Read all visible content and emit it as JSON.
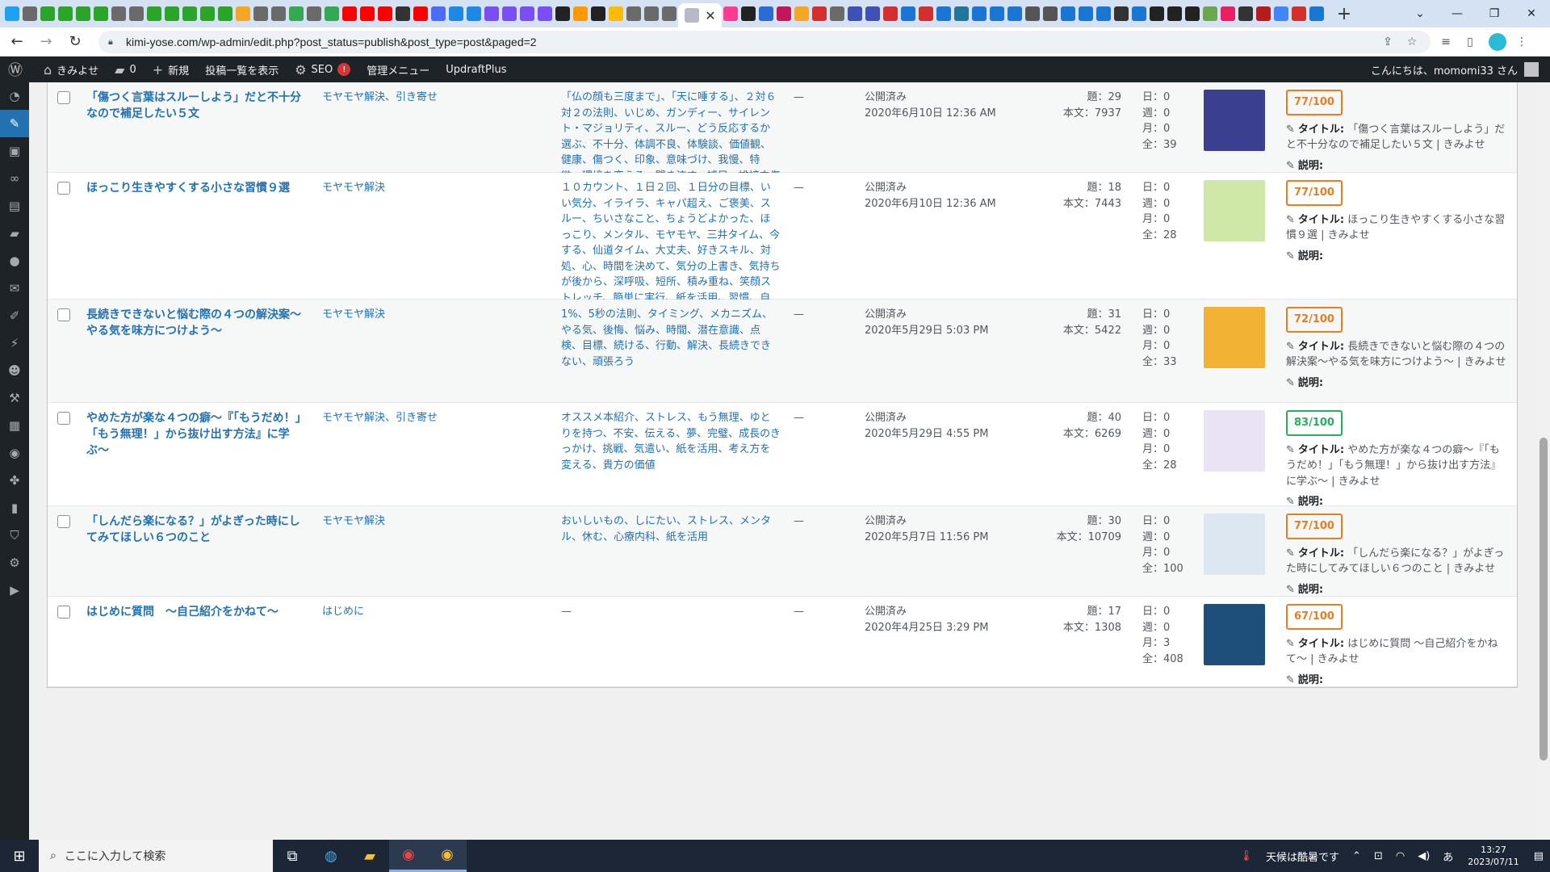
{
  "browser": {
    "active_tab_close": "✕",
    "new_tab": "+",
    "url": "kimi-yose.com/wp-admin/edit.php?post_status=publish&post_type=post&paged=2",
    "window_controls": [
      "⌄",
      "—",
      "❐",
      "✕"
    ]
  },
  "adminbar": {
    "site_name": "きみよせ",
    "comments_count": "0",
    "new_label": "新規",
    "view_posts": "投稿一覧を表示",
    "seo_label": "SEO",
    "seo_badge": "!",
    "admin_menu": "管理メニュー",
    "updraft": "UpdraftPlus",
    "greeting": "こんにちは、momomi33 さん"
  },
  "posts": [
    {
      "title": "「傷つく言葉はスルーしよう」だと不十分なので補足したい５文",
      "categories": "モヤモヤ解決、引き寄せ",
      "tags": "「仏の顔も三度まで」、「天に唾する」、２対６対２の法則、いじめ、ガンディー、サイレント・マジョリティ、スルー、どう反応するか選ぶ、不十分、体調不良、体験談、価値観、健康、傷つく、印象、意味づけ、我慢、特徴、環境を変える、聞き流す、補足、誹謗中傷",
      "comments": "—",
      "status": "公開済み",
      "date": "2020年6月10日 12:36 AM",
      "title_chars": "題：29",
      "body_chars": "本文：7937",
      "views": [
        "日：0",
        "週：0",
        "月：0",
        "全：39"
      ],
      "thumb_color": "#3b3f8f",
      "score": "77/100",
      "score_color": "orange",
      "seo_title_label": "タイトル:",
      "seo_title": "「傷つく言葉はスルーしよう」だと不十分なので補足したい５文 | きみよせ",
      "seo_desc_label": "説明:"
    },
    {
      "title": "ほっこり生きやすくする小さな習慣９選",
      "categories": "モヤモヤ解決",
      "tags": "１０カウント、１日２回、１日分の目標、いい気分、イライラ、キャパ超え、ご褒美、スルー、ちいさなこと、ちょうどよかった、ほっこり、メンタル、モヤモヤ、三井タイム、今する、仙道タイム、大丈夫、好きスキル、対処、心、時間を決めて、気分の上書き、気持ちが後から、深呼吸、短所、積み重ね、笑顔ストレッチ、簡単に実行、紙を活用、習慣、自信、落ち込む、重要なこと、長所、面倒",
      "comments": "—",
      "status": "公開済み",
      "date": "2020年6月10日 12:36 AM",
      "title_chars": "題：18",
      "body_chars": "本文：7443",
      "views": [
        "日：0",
        "週：0",
        "月：0",
        "全：28"
      ],
      "thumb_color": "#cfe8a8",
      "score": "77/100",
      "score_color": "orange",
      "seo_title_label": "タイトル:",
      "seo_title": "ほっこり生きやすくする小さな習慣９選 | きみよせ",
      "seo_desc_label": "説明:"
    },
    {
      "title": "長続きできないと悩む際の４つの解決案〜やる気を味方につけよう〜",
      "categories": "モヤモヤ解決",
      "tags": "1%、5秒の法則、タイミング、メカニズム、やる気、後悔、悩み、時間、潜在意識、点検、目標、続ける、行動、解決、長続きできない、頑張ろう",
      "comments": "—",
      "status": "公開済み",
      "date": "2020年5月29日 5:03 PM",
      "title_chars": "題：31",
      "body_chars": "本文：5422",
      "views": [
        "日：0",
        "週：0",
        "月：0",
        "全：33"
      ],
      "thumb_color": "#f2b233",
      "score": "72/100",
      "score_color": "orange",
      "seo_title_label": "タイトル:",
      "seo_title": "長続きできないと悩む際の４つの解決案〜やる気を味方につけよう〜 | きみよせ",
      "seo_desc_label": "説明:"
    },
    {
      "title": "やめた方が楽な４つの癖〜『「もうだめ！」「もう無理！」から抜け出す方法』に学ぶ〜",
      "categories": "モヤモヤ解決、引き寄せ",
      "tags": "オススメ本紹介、ストレス、もう無理、ゆとりを持つ、不安、伝える、夢、完璧、成長のきっかけ、挑戦、気遣い、紙を活用、考え方を変える、貴方の価値",
      "comments": "—",
      "status": "公開済み",
      "date": "2020年5月29日 4:55 PM",
      "title_chars": "題：40",
      "body_chars": "本文：6269",
      "views": [
        "日：0",
        "週：0",
        "月：0",
        "全：28"
      ],
      "thumb_color": "#e9e3f5",
      "score": "83/100",
      "score_color": "green",
      "seo_title_label": "タイトル:",
      "seo_title": "やめた方が楽な４つの癖〜『「もうだめ！」「もう無理！」から抜け出す方法』に学ぶ〜 | きみよせ",
      "seo_desc_label": "説明:"
    },
    {
      "title": "「しんだら楽になる？」がよぎった時にしてみてほしい６つのこと",
      "categories": "モヤモヤ解決",
      "tags": "おいしいもの、しにたい、ストレス、メンタル、休む、心療内科、紙を活用",
      "comments": "—",
      "status": "公開済み",
      "date": "2020年5月7日 11:56 PM",
      "title_chars": "題：30",
      "body_chars": "本文：10709",
      "views": [
        "日：0",
        "週：0",
        "月：0",
        "全：100"
      ],
      "thumb_color": "#dde7f2",
      "score": "77/100",
      "score_color": "orange",
      "seo_title_label": "タイトル:",
      "seo_title": "「しんだら楽になる？」がよぎった時にしてみてほしい６つのこと | きみよせ",
      "seo_desc_label": "説明:"
    },
    {
      "title": "はじめに質問　〜自己紹介をかねて〜",
      "categories": "はじめに",
      "tags": "—",
      "comments": "—",
      "status": "公開済み",
      "date": "2020年4月25日 3:29 PM",
      "title_chars": "題：17",
      "body_chars": "本文：1308",
      "views": [
        "日：0",
        "週：0",
        "月：3",
        "全：408"
      ],
      "thumb_color": "#1d4f7a",
      "score": "67/100",
      "score_color": "orange",
      "seo_title_label": "タイトル:",
      "seo_title": "はじめに質問 〜自己紹介をかねて〜 | きみよせ",
      "seo_desc_label": "説明:"
    }
  ],
  "taskbar": {
    "search_placeholder": "ここに入力して検索",
    "weather": "天候は酷暑です",
    "time": "13:27",
    "date": "2023/07/11",
    "ime": "あ"
  }
}
